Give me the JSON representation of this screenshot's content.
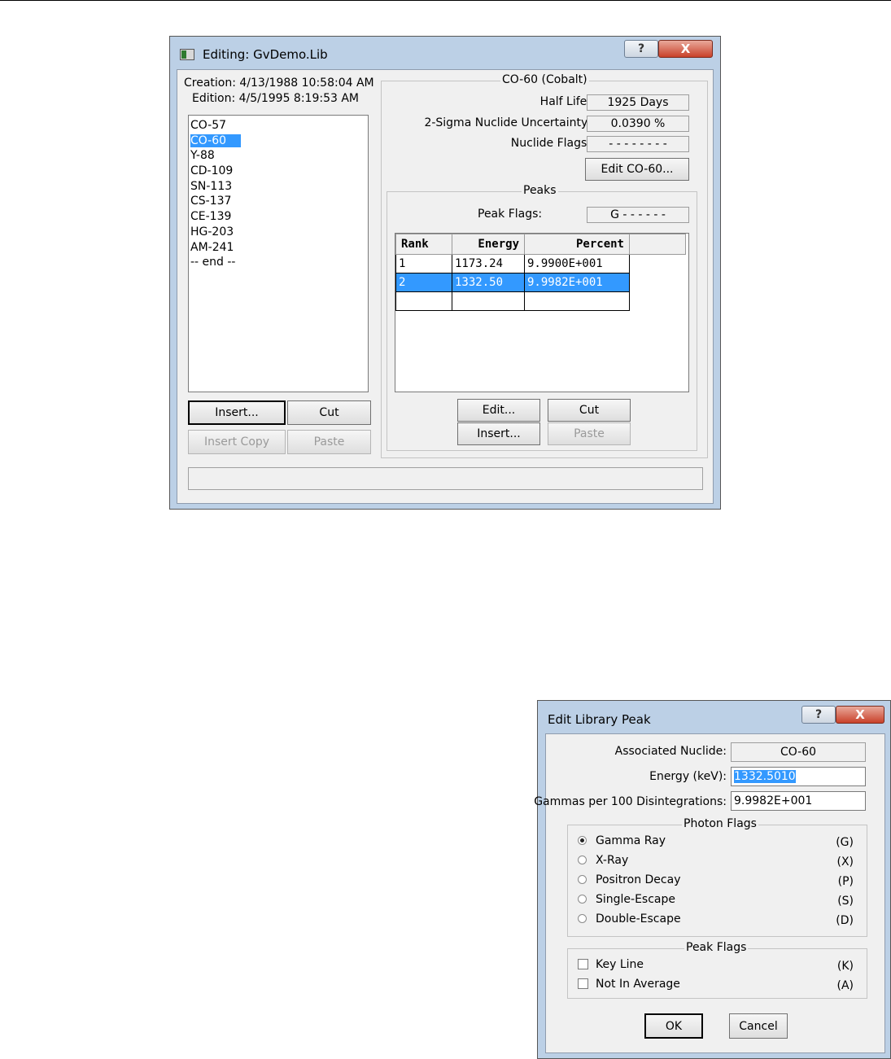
{
  "editor": {
    "title": "Editing: GvDemo.Lib",
    "help_glyph": "?",
    "close_glyph": "X",
    "creation": "Creation: 4/13/1988  10:58:04 AM",
    "edition": "Edition: 4/5/1995  8:19:53 AM",
    "nuclides": [
      "CO-57",
      "CO-60",
      "Y-88",
      "CD-109",
      "SN-113",
      "CS-137",
      "CE-139",
      "HG-203",
      "AM-241",
      "-- end --"
    ],
    "selected_nuclide_index": 1,
    "left_buttons": {
      "insert": "Insert...",
      "cut": "Cut",
      "insert_copy": "Insert Copy",
      "paste": "Paste"
    },
    "nuclide_group": {
      "caption": "CO-60 (Cobalt)",
      "half_life_label": "Half Life:",
      "half_life_value": "1925 Days",
      "uncertainty_label": "2-Sigma Nuclide Uncertainty:",
      "uncertainty_value": "0.0390 %",
      "flags_label": "Nuclide Flags:",
      "flags_value": "- - - - - - - -",
      "edit_button": "Edit CO-60..."
    },
    "peaks_group": {
      "caption": "Peaks",
      "peak_flags_label": "Peak Flags:",
      "peak_flags_value": "G - - - - - -",
      "columns": [
        "Rank",
        "Energy",
        "Percent"
      ],
      "rows": [
        [
          "1",
          "1173.24",
          "9.9900E+001"
        ],
        [
          "2",
          "1332.50",
          "9.9982E+001"
        ],
        [
          "",
          "",
          ""
        ]
      ],
      "selected_row_index": 1,
      "buttons": {
        "edit": "Edit...",
        "cut": "Cut",
        "insert": "Insert...",
        "paste": "Paste"
      }
    }
  },
  "peak_dialog": {
    "title": "Edit Library Peak",
    "help_glyph": "?",
    "close_glyph": "X",
    "associated_label": "Associated Nuclide:",
    "associated_value": "CO-60",
    "energy_label": "Energy (keV):",
    "energy_value": "1332.5010",
    "gammas_label": "Gammas per 100 Disintegrations:",
    "gammas_value": "9.9982E+001",
    "photon_flags": {
      "caption": "Photon Flags",
      "options": [
        {
          "label": "Gamma Ray",
          "code": "(G)",
          "checked": true
        },
        {
          "label": "X-Ray",
          "code": "(X)",
          "checked": false
        },
        {
          "label": "Positron Decay",
          "code": "(P)",
          "checked": false
        },
        {
          "label": "Single-Escape",
          "code": "(S)",
          "checked": false
        },
        {
          "label": "Double-Escape",
          "code": "(D)",
          "checked": false
        }
      ]
    },
    "peak_flags": {
      "caption": "Peak Flags",
      "options": [
        {
          "label": "Key Line",
          "code": "(K)",
          "checked": false
        },
        {
          "label": "Not In Average",
          "code": "(A)",
          "checked": false
        }
      ]
    },
    "ok": "OK",
    "cancel": "Cancel"
  }
}
